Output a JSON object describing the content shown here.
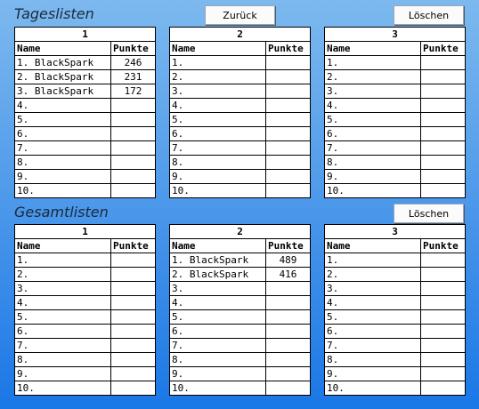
{
  "daily": {
    "title": "Tageslisten",
    "back_label": "Zurück",
    "clear_label": "Löschen",
    "tables": [
      {
        "header": "1",
        "col_name": "Name",
        "col_points": "Punkte",
        "rows": [
          [
            "1. BlackSpark",
            "246"
          ],
          [
            "2. BlackSpark",
            "231"
          ],
          [
            "3. BlackSpark",
            "172"
          ],
          [
            "4.",
            ""
          ],
          [
            "5.",
            ""
          ],
          [
            "6.",
            ""
          ],
          [
            "7.",
            ""
          ],
          [
            "8.",
            ""
          ],
          [
            "9.",
            ""
          ],
          [
            "10.",
            ""
          ]
        ]
      },
      {
        "header": "2",
        "col_name": "Name",
        "col_points": "Punkte",
        "rows": [
          [
            "1.",
            ""
          ],
          [
            "2.",
            ""
          ],
          [
            "3.",
            ""
          ],
          [
            "4.",
            ""
          ],
          [
            "5.",
            ""
          ],
          [
            "6.",
            ""
          ],
          [
            "7.",
            ""
          ],
          [
            "8.",
            ""
          ],
          [
            "9.",
            ""
          ],
          [
            "10.",
            ""
          ]
        ]
      },
      {
        "header": "3",
        "col_name": "Name",
        "col_points": "Punkte",
        "rows": [
          [
            "1.",
            ""
          ],
          [
            "2.",
            ""
          ],
          [
            "3.",
            ""
          ],
          [
            "4.",
            ""
          ],
          [
            "5.",
            ""
          ],
          [
            "6.",
            ""
          ],
          [
            "7.",
            ""
          ],
          [
            "8.",
            ""
          ],
          [
            "9.",
            ""
          ],
          [
            "10.",
            ""
          ]
        ]
      }
    ]
  },
  "overall": {
    "title": "Gesamtlisten",
    "clear_label": "Löschen",
    "tables": [
      {
        "header": "1",
        "col_name": "Name",
        "col_points": "Punkte",
        "rows": [
          [
            "1.",
            ""
          ],
          [
            "2.",
            ""
          ],
          [
            "3.",
            ""
          ],
          [
            "4.",
            ""
          ],
          [
            "5.",
            ""
          ],
          [
            "6.",
            ""
          ],
          [
            "7.",
            ""
          ],
          [
            "8.",
            ""
          ],
          [
            "9.",
            ""
          ],
          [
            "10.",
            ""
          ]
        ]
      },
      {
        "header": "2",
        "col_name": "Name",
        "col_points": "Punkte",
        "rows": [
          [
            "1. BlackSpark",
            "489"
          ],
          [
            "2. BlackSpark",
            "416"
          ],
          [
            "3.",
            ""
          ],
          [
            "4.",
            ""
          ],
          [
            "5.",
            ""
          ],
          [
            "6.",
            ""
          ],
          [
            "7.",
            ""
          ],
          [
            "8.",
            ""
          ],
          [
            "9.",
            ""
          ],
          [
            "10.",
            ""
          ]
        ]
      },
      {
        "header": "3",
        "col_name": "Name",
        "col_points": "Punkte",
        "rows": [
          [
            "1.",
            ""
          ],
          [
            "2.",
            ""
          ],
          [
            "3.",
            ""
          ],
          [
            "4.",
            ""
          ],
          [
            "5.",
            ""
          ],
          [
            "6.",
            ""
          ],
          [
            "7.",
            ""
          ],
          [
            "8.",
            ""
          ],
          [
            "9.",
            ""
          ],
          [
            "10.",
            ""
          ]
        ]
      }
    ]
  }
}
